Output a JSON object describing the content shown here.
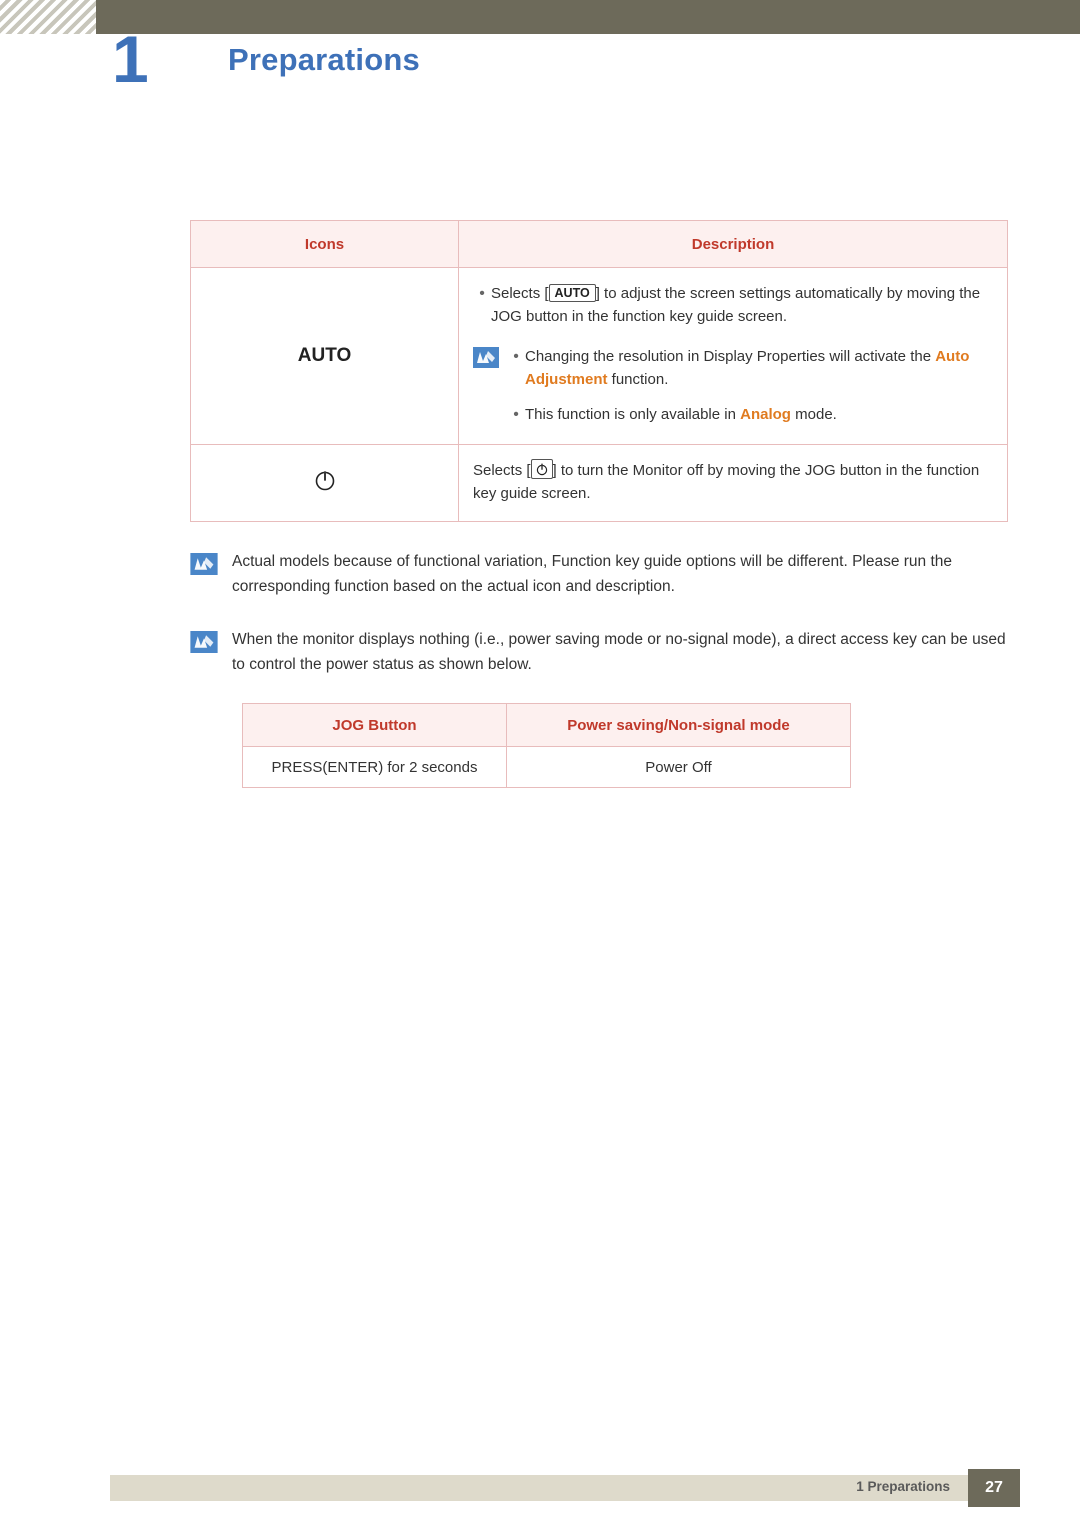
{
  "header": {
    "chapter_number": "1",
    "chapter_title": "Preparations"
  },
  "icons_table": {
    "headers": {
      "icons": "Icons",
      "description": "Description"
    },
    "rows": [
      {
        "icon_label": "AUTO",
        "bullets": [
          {
            "prefix": "Selects [",
            "key": "AUTO",
            "suffix": "] to adjust the screen settings automatically by moving the JOG button in the function key guide screen."
          }
        ],
        "note_bullets": [
          {
            "text_before": "Changing the resolution in Display Properties will activate the ",
            "highlight": "Auto Adjustment",
            "text_after": " function."
          },
          {
            "text_before": "This function is only available in ",
            "highlight": "Analog",
            "text_after": " mode."
          }
        ]
      },
      {
        "icon_label": "power-icon",
        "text_before": "Selects [",
        "key": "power",
        "text_after": "] to turn the Monitor off by moving the JOG button in the function key guide screen."
      }
    ]
  },
  "notes": [
    {
      "icon": "note-icon",
      "text": "Actual models because of functional variation, Function key guide options will be different. Please run the corresponding function based on the actual icon and description."
    },
    {
      "icon": "note-icon",
      "text": "When the monitor displays nothing (i.e., power saving mode or no-signal mode), a direct access key can be used to control the power status as shown below."
    }
  ],
  "jog_table": {
    "headers": {
      "col1": "JOG Button",
      "col2": "Power saving/Non-signal mode"
    },
    "rows": [
      {
        "col1": "PRESS(ENTER) for 2 seconds",
        "col2": "Power Off"
      }
    ]
  },
  "footer": {
    "label": "1 Preparations",
    "page_number": "27"
  }
}
